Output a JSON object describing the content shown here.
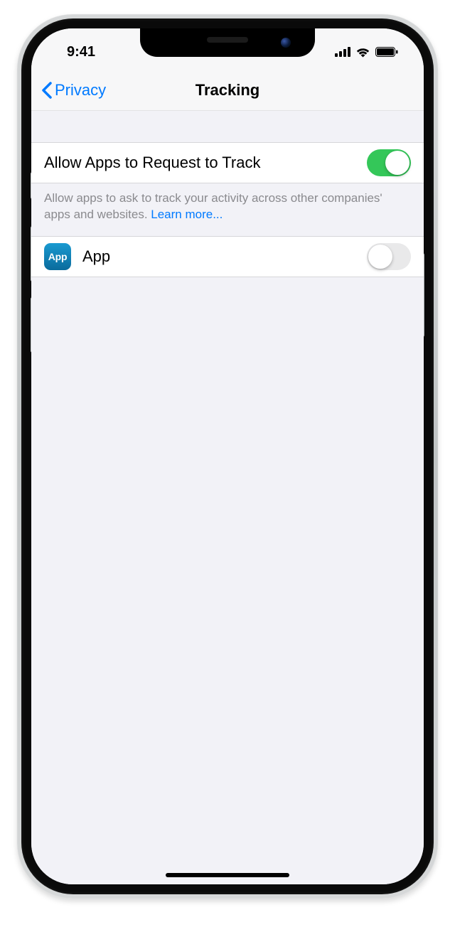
{
  "status": {
    "time": "9:41"
  },
  "nav": {
    "back_label": "Privacy",
    "title": "Tracking"
  },
  "main_toggle": {
    "label": "Allow Apps to Request to Track",
    "on": true
  },
  "footer": {
    "text": "Allow apps to ask to track your activity across other companies' apps and websites. ",
    "learn_more": "Learn more..."
  },
  "app_row": {
    "icon_text": "App",
    "label": "App",
    "on": false
  }
}
